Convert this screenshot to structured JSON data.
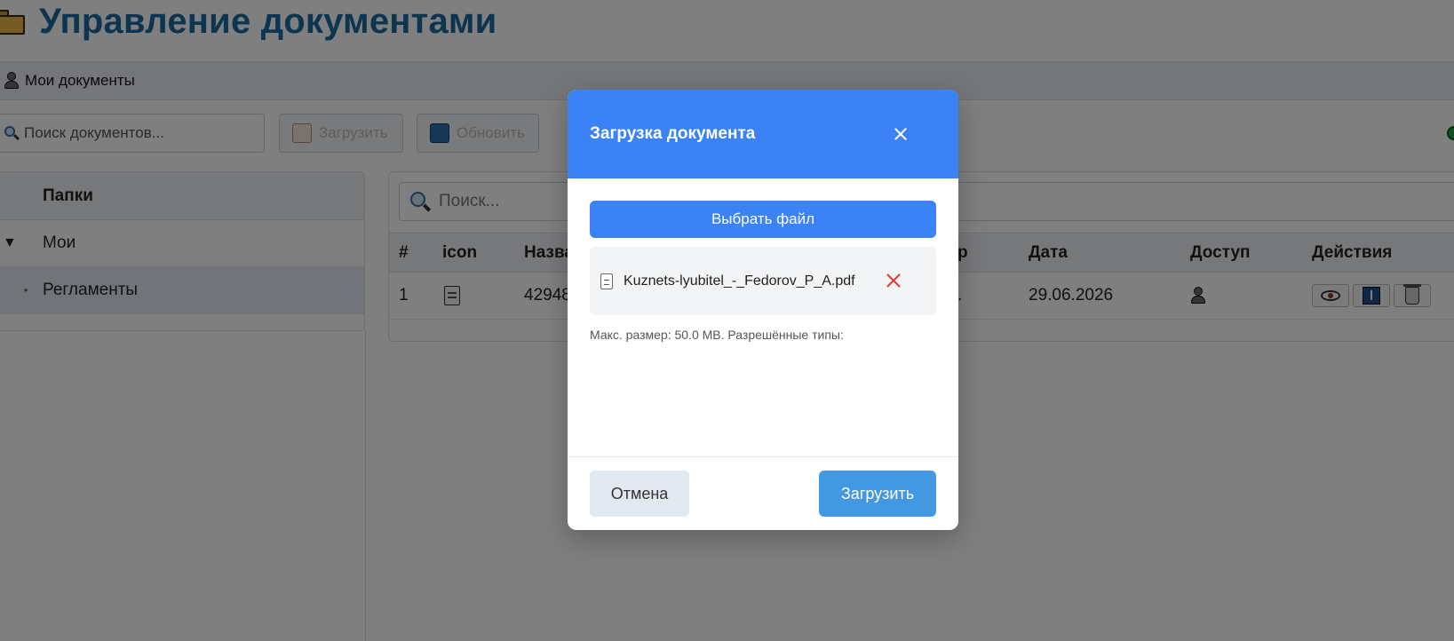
{
  "app": {
    "title": "Управление документами"
  },
  "top_bar": {
    "label": "Мои документы"
  },
  "toolbar": {
    "search_placeholder": "Поиск документов...",
    "upload_label": "Загрузить",
    "refresh_label": "Обновить"
  },
  "folders": {
    "header": "Папки",
    "items": [
      {
        "toggle": "▼",
        "label": "Мои"
      },
      {
        "toggle": "•",
        "label": "Регламенты"
      }
    ]
  },
  "table": {
    "search_placeholder": "Поиск...",
    "columns": [
      "#",
      "icon",
      "Назва",
      "р",
      "Дата",
      "Доступ",
      "Действия"
    ],
    "rows": [
      {
        "num": "1",
        "name": "42948",
        "size": ".",
        "date": "29.06.2026"
      }
    ]
  },
  "modal": {
    "title": "Загрузка документа",
    "choose_label": "Выбрать файл",
    "file_name": "Kuznets-lyubitel_-_Fedorov_P_A.pdf",
    "limits": "Макс. размер: 50.0 MB. Разрешённые типы:",
    "cancel_label": "Отмена",
    "submit_label": "Загрузить"
  },
  "colors": {
    "accent": "#3b82f6",
    "submit": "#4299e1",
    "remove": "#e53935",
    "title": "#1c6b9e"
  }
}
